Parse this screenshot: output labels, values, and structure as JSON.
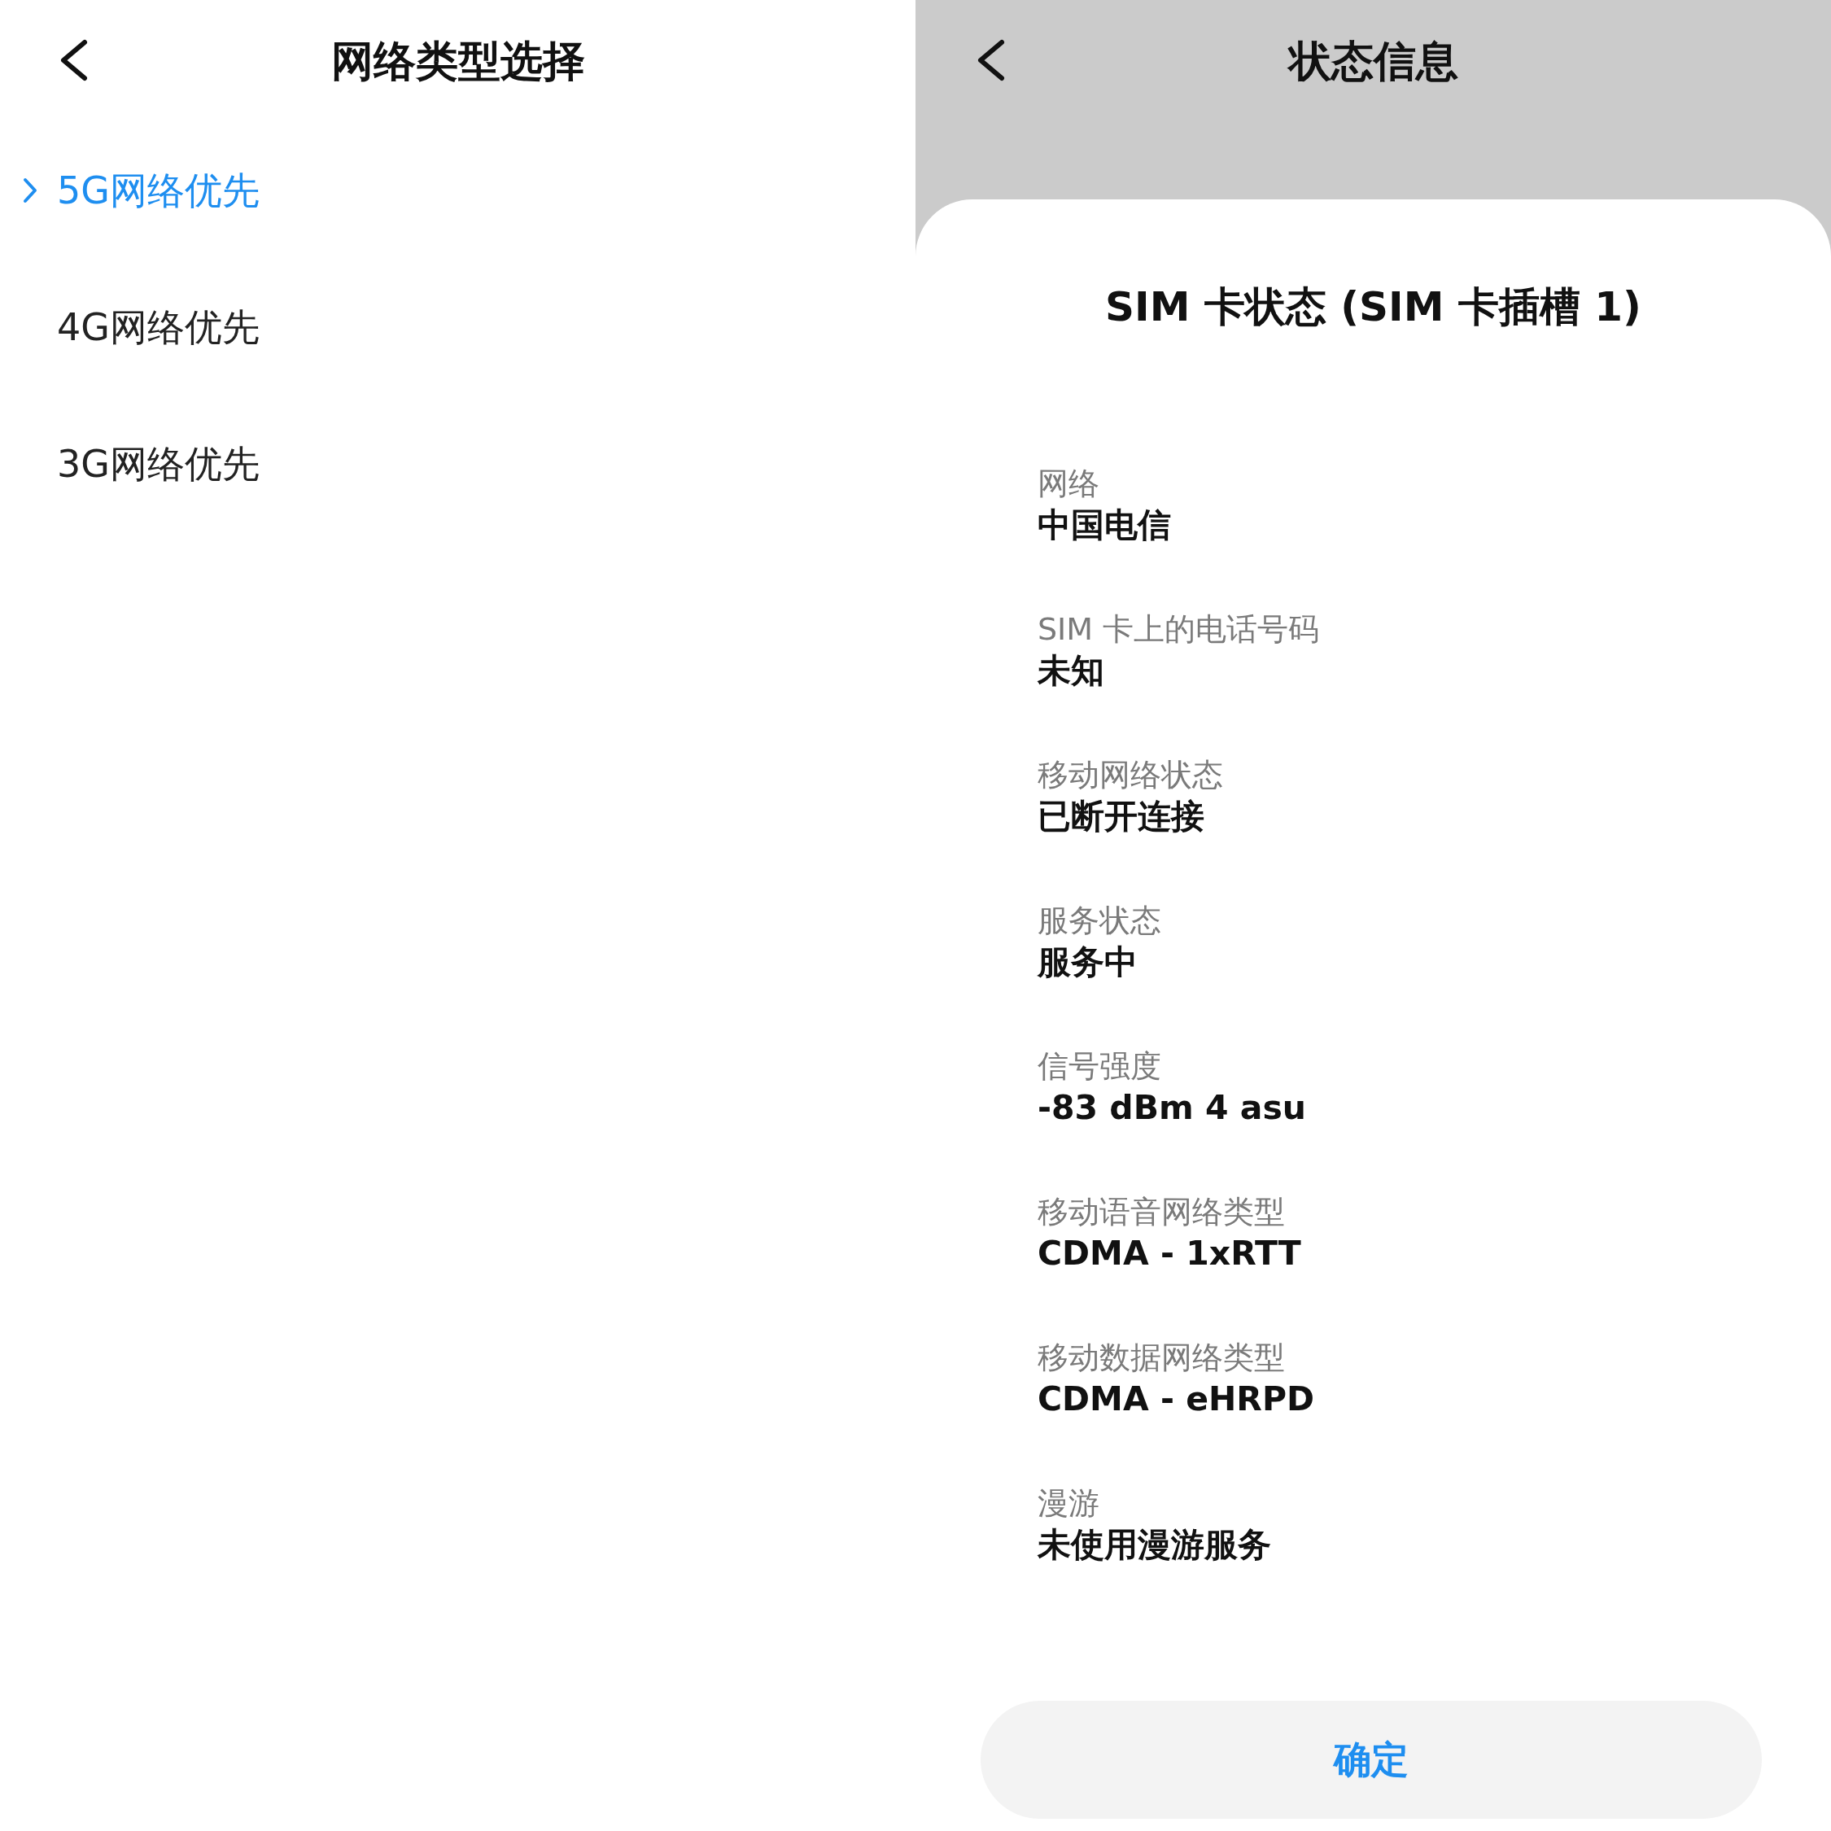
{
  "left_screen": {
    "title": "网络类型选择",
    "options": [
      {
        "label": "5G网络优先",
        "selected": true
      },
      {
        "label": "4G网络优先",
        "selected": false
      },
      {
        "label": "3G网络优先",
        "selected": false
      }
    ]
  },
  "right_screen": {
    "title": "状态信息",
    "sheet": {
      "title": "SIM 卡状态 (SIM 卡插槽 1)",
      "fields": [
        {
          "label": "网络",
          "value": "中国电信"
        },
        {
          "label": "SIM 卡上的电话号码",
          "value": "未知"
        },
        {
          "label": "移动网络状态",
          "value": "已断开连接"
        },
        {
          "label": "服务状态",
          "value": "服务中"
        },
        {
          "label": "信号强度",
          "value": "-83 dBm 4 asu"
        },
        {
          "label": "移动语音网络类型",
          "value": "CDMA - 1xRTT"
        },
        {
          "label": "移动数据网络类型",
          "value": "CDMA - eHRPD"
        },
        {
          "label": "漫游",
          "value": "未使用漫游服务"
        }
      ],
      "button": "确定"
    }
  }
}
